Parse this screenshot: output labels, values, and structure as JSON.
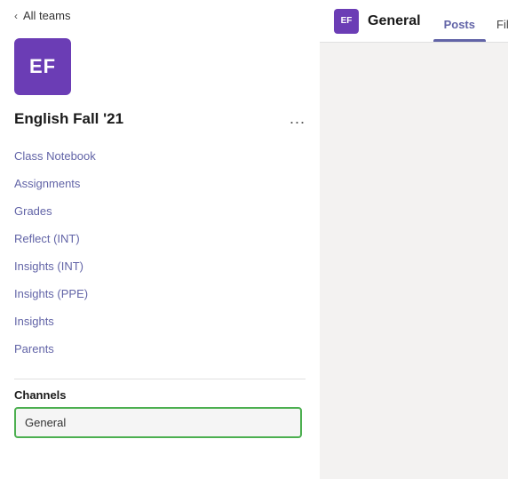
{
  "sidebar": {
    "back_label": "All teams",
    "team": {
      "avatar_text": "EF",
      "name": "English Fall '21",
      "menu_dots": "..."
    },
    "nav_items": [
      {
        "label": "Class Notebook"
      },
      {
        "label": "Assignments"
      },
      {
        "label": "Grades"
      },
      {
        "label": "Reflect (INT)"
      },
      {
        "label": "Insights (INT)"
      },
      {
        "label": "Insights (PPE)"
      },
      {
        "label": "Insights"
      },
      {
        "label": "Parents"
      }
    ],
    "channels_label": "Channels",
    "channels": [
      {
        "label": "General",
        "active": true
      }
    ]
  },
  "right_panel": {
    "channel_avatar_text": "EF",
    "channel_title": "General",
    "tabs": [
      {
        "label": "Posts",
        "active": true
      },
      {
        "label": "Files",
        "active": false
      }
    ]
  }
}
